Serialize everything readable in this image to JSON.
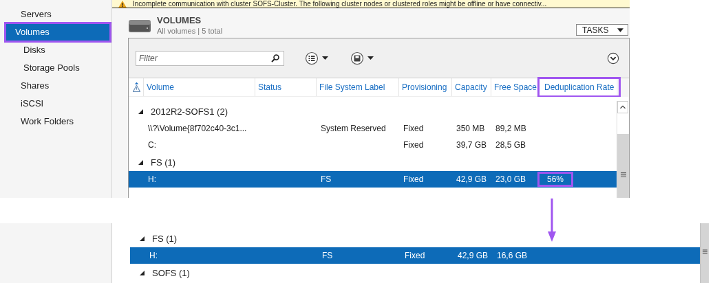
{
  "banner": {
    "text": "Incomplete communication with cluster SOFS-Cluster. The following cluster nodes or clustered roles might be offline or have connectiv..."
  },
  "sidebar": {
    "items": [
      {
        "label": "Servers",
        "selected": false,
        "highlighted": false
      },
      {
        "label": "Volumes",
        "selected": true,
        "highlighted": true,
        "children": [
          {
            "label": "Disks",
            "selected": false,
            "highlighted": false
          },
          {
            "label": "Storage Pools",
            "selected": false,
            "highlighted": false
          }
        ]
      },
      {
        "label": "Shares",
        "selected": false,
        "highlighted": false
      },
      {
        "label": "iSCSI",
        "selected": false,
        "highlighted": false
      },
      {
        "label": "Work Folders",
        "selected": false,
        "highlighted": false
      }
    ]
  },
  "volumes_panel": {
    "title": "VOLUMES",
    "subtitle": "All volumes | 5 total",
    "tasks_button": "TASKS",
    "filter": {
      "placeholder": "Filter"
    },
    "table": {
      "columns": [
        {
          "label": "Volume",
          "highlighted": false
        },
        {
          "label": "Status",
          "highlighted": false
        },
        {
          "label": "File System Label",
          "highlighted": false
        },
        {
          "label": "Provisioning",
          "highlighted": false
        },
        {
          "label": "Capacity",
          "highlighted": false
        },
        {
          "label": "Free Space",
          "highlighted": false
        },
        {
          "label": "Deduplication Rate",
          "highlighted": true
        }
      ],
      "groups": [
        {
          "label": "2012R2-SOFS1 (2)",
          "expanded": true,
          "rows": [
            {
              "selected": false,
              "cells": [
                {
                  "text": "\\\\?\\Volume{8f702c40-3c1...",
                  "highlighted": false
                },
                null,
                {
                  "text": "System Reserved",
                  "highlighted": false
                },
                {
                  "text": "Fixed",
                  "highlighted": false
                },
                {
                  "text": "350 MB",
                  "highlighted": false
                },
                {
                  "text": "89,2 MB",
                  "highlighted": false
                },
                null
              ]
            },
            {
              "selected": false,
              "cells": [
                {
                  "text": "C:",
                  "highlighted": false
                },
                null,
                null,
                {
                  "text": "Fixed",
                  "highlighted": false
                },
                {
                  "text": "39,7 GB",
                  "highlighted": false
                },
                {
                  "text": "28,5 GB",
                  "highlighted": false
                },
                null
              ]
            }
          ]
        },
        {
          "label": "FS (1)",
          "expanded": true,
          "rows": [
            {
              "selected": true,
              "cells": [
                {
                  "text": "H:",
                  "highlighted": false
                },
                null,
                {
                  "text": "FS",
                  "highlighted": false
                },
                {
                  "text": "Fixed",
                  "highlighted": false
                },
                {
                  "text": "42,9 GB",
                  "highlighted": false
                },
                {
                  "text": "23,0 GB",
                  "highlighted": false
                },
                {
                  "text": "56%",
                  "highlighted": true
                }
              ]
            }
          ]
        }
      ]
    }
  },
  "detail_view": {
    "groups": [
      {
        "label": "FS (1)",
        "expanded": true,
        "rows": [
          {
            "selected": true,
            "cells": [
              {
                "text": "H:",
                "highlighted": false
              },
              null,
              {
                "text": "FS",
                "highlighted": false
              },
              {
                "text": "Fixed",
                "highlighted": false
              },
              {
                "text": "42,9 GB",
                "highlighted": false
              },
              {
                "text": "16,6 GB",
                "highlighted": false
              },
              null
            ]
          }
        ]
      },
      {
        "label": "SOFS (1)",
        "expanded": true
      }
    ]
  }
}
